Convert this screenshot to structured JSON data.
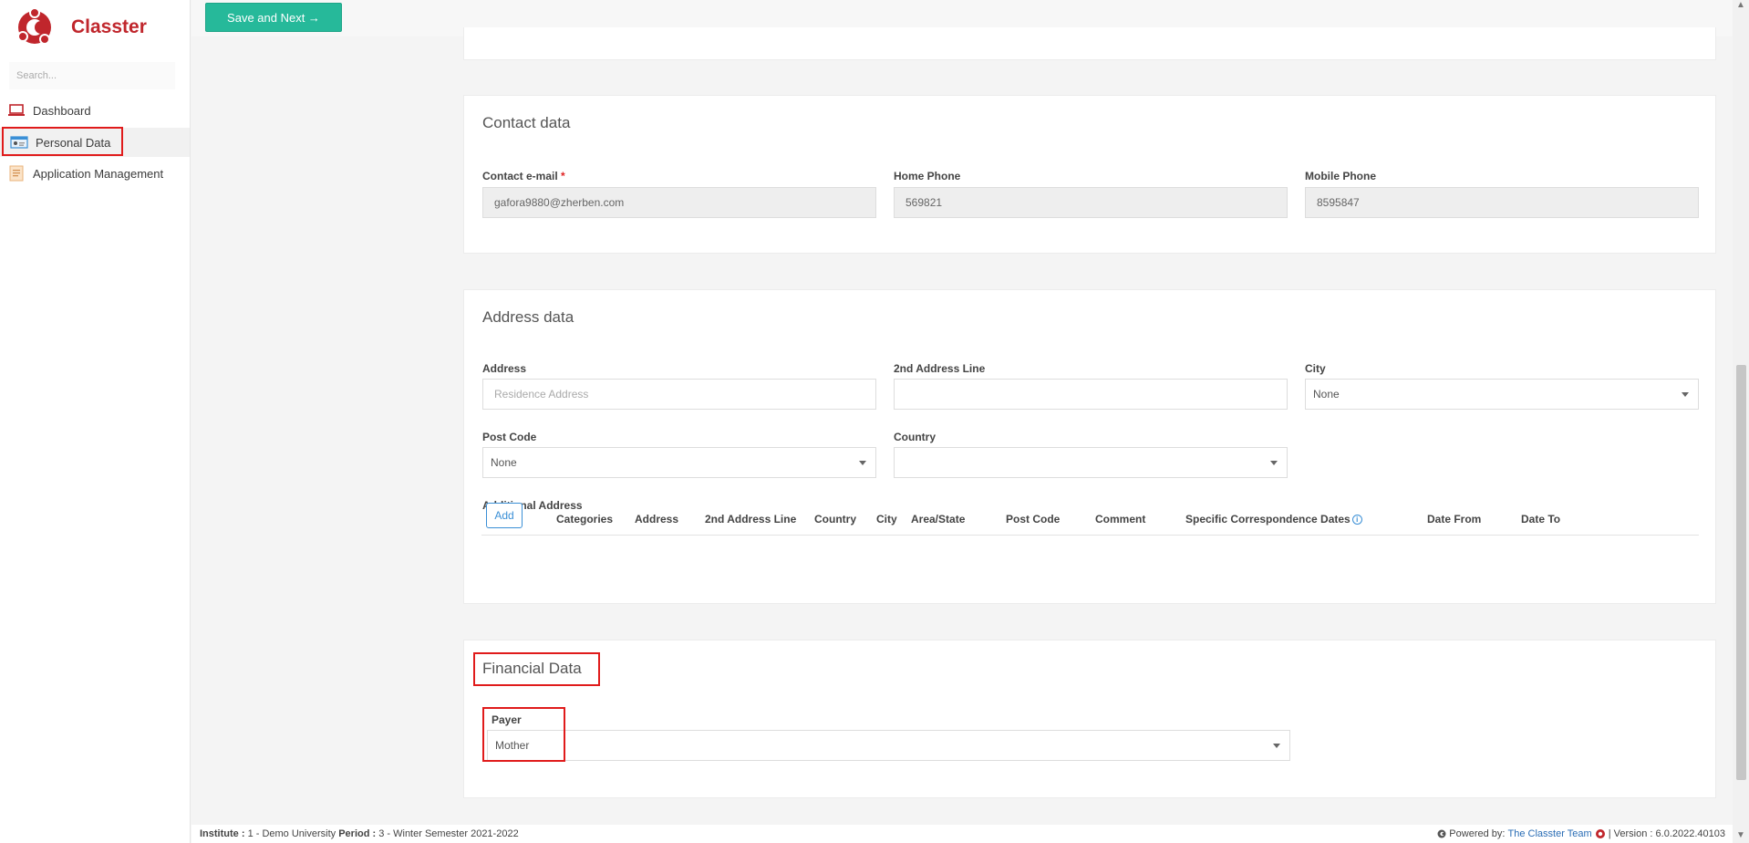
{
  "app": {
    "name": "Classter"
  },
  "sidebar": {
    "search_placeholder": "Search...",
    "items": [
      {
        "label": "Dashboard",
        "icon": "laptop-icon"
      },
      {
        "label": "Personal Data",
        "icon": "id-card-icon"
      },
      {
        "label": "Application Management",
        "icon": "document-icon"
      }
    ]
  },
  "toolbar": {
    "save_next_label": "Save and Next →"
  },
  "contact": {
    "title": "Contact data",
    "email_label": "Contact e-mail",
    "email_required": "*",
    "email_value": "gafora9880@zherben.com",
    "home_phone_label": "Home Phone",
    "home_phone_value": "569821",
    "mobile_phone_label": "Mobile Phone",
    "mobile_phone_value": "8595847"
  },
  "address": {
    "title": "Address data",
    "address_label": "Address",
    "address_placeholder": "Residence Address",
    "line2_label": "2nd Address Line",
    "city_label": "City",
    "city_value": "None",
    "postcode_label": "Post Code",
    "postcode_value": "None",
    "country_label": "Country",
    "country_value": "",
    "additional_label": "Additional Address",
    "add_button": "Add",
    "columns": [
      "Categories",
      "Address",
      "2nd Address Line",
      "Country",
      "City",
      "Area/State",
      "Post Code",
      "Comment",
      "Specific Correspondence Dates",
      "Date From",
      "Date To"
    ],
    "info_glyph": "i"
  },
  "financial": {
    "title": "Financial Data",
    "payer_label": "Payer",
    "payer_value": "Mother"
  },
  "footer": {
    "institute_label": "Institute :",
    "institute_value": "1 - Demo University",
    "period_label": "Period :",
    "period_value": "3 - Winter Semester 2021-2022",
    "powered_label": "Powered by:",
    "powered_link": "The Classter Team",
    "version_text": "| Version : 6.0.2022.40103"
  },
  "colors": {
    "brand": "#c0262c",
    "accent": "#26b99a",
    "highlight": "#e01b1b",
    "link": "#2a6db5"
  }
}
